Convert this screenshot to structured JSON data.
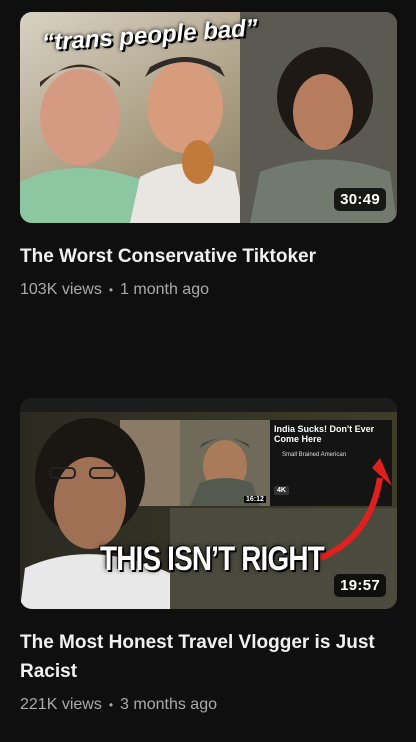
{
  "videos": [
    {
      "thumbnail_caption": "“trans people bad”",
      "duration": "30:49",
      "title": "The Worst Conservative Tiktoker",
      "views": "103K views",
      "age": "1 month ago"
    },
    {
      "thumbnail_caption": "THIS ISN’T RIGHT",
      "inset_title": "India Sucks! Don't Ever Come Here",
      "inset_channel": "Small Brained American",
      "inset_badge": "4K",
      "inset_duration": "16:12",
      "duration": "19:57",
      "title": "The Most Honest Travel Vlogger is Just Racist",
      "views": "221K views",
      "age": "3 months ago"
    }
  ],
  "colors": {
    "background": "#0f0f0f",
    "title": "#f1f1f1",
    "meta": "#aaaaaa",
    "arrow": "#e0201e"
  }
}
